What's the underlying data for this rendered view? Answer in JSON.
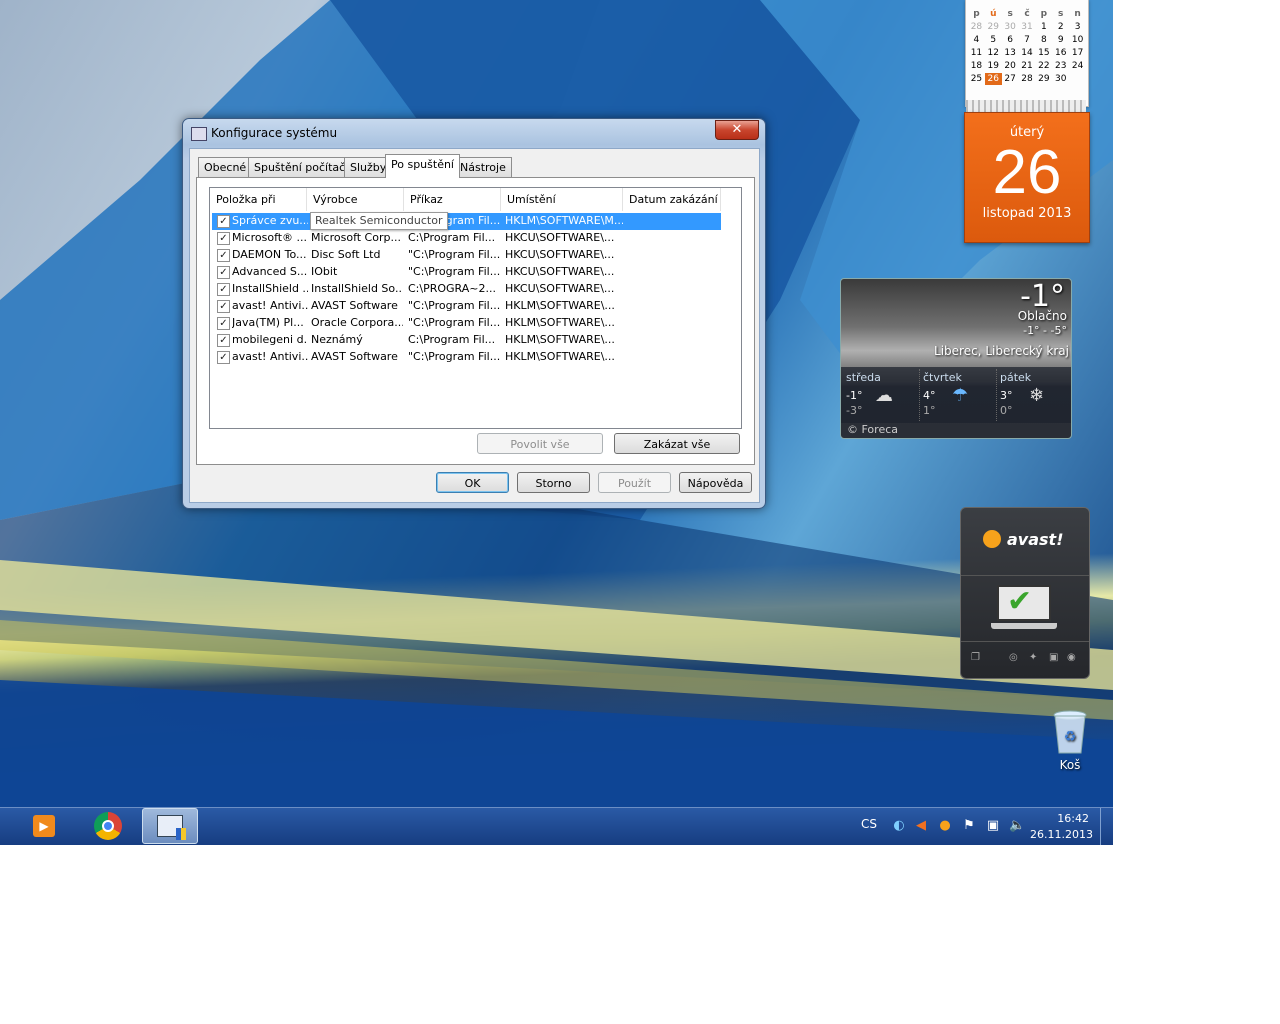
{
  "dialog": {
    "title": "Konfigurace systému",
    "close_label": "✕",
    "tabs": [
      {
        "label": "Obecné"
      },
      {
        "label": "Spuštění počítače"
      },
      {
        "label": "Služby"
      },
      {
        "label": "Po spuštění"
      },
      {
        "label": "Nástroje"
      }
    ],
    "active_tab": "Po spuštění",
    "columns": [
      "Položka při spu...",
      "Výrobce",
      "Příkaz",
      "Umístění",
      "Datum zakázání"
    ],
    "rows": [
      {
        "item": "Správce zvu...",
        "maker": "Realtek Semiconductor",
        "command": "\"C:\\Program Fil...",
        "location": "HKLM\\SOFTWARE\\M...",
        "date": "",
        "checked": true
      },
      {
        "item": "Microsoft® ...",
        "maker": "Microsoft Corp...",
        "command": "C:\\Program Fil...",
        "location": "HKCU\\SOFTWARE\\...",
        "date": "",
        "checked": true
      },
      {
        "item": "DAEMON To...",
        "maker": "Disc Soft Ltd",
        "command": "\"C:\\Program Fil...",
        "location": "HKCU\\SOFTWARE\\...",
        "date": "",
        "checked": true
      },
      {
        "item": "Advanced S...",
        "maker": "IObit",
        "command": "\"C:\\Program Fil...",
        "location": "HKCU\\SOFTWARE\\...",
        "date": "",
        "checked": true
      },
      {
        "item": "InstallShield ...",
        "maker": "InstallShield So...",
        "command": "C:\\PROGRA~2...",
        "location": "HKCU\\SOFTWARE\\...",
        "date": "",
        "checked": true
      },
      {
        "item": "avast! Antivi...",
        "maker": "AVAST Software",
        "command": "\"C:\\Program Fil...",
        "location": "HKLM\\SOFTWARE\\...",
        "date": "",
        "checked": true
      },
      {
        "item": "Java(TM) Pl...",
        "maker": "Oracle Corpora...",
        "command": "\"C:\\Program Fil...",
        "location": "HKLM\\SOFTWARE\\...",
        "date": "",
        "checked": true
      },
      {
        "item": "mobilegeni d...",
        "maker": "Neznámý",
        "command": "C:\\Program Fil...",
        "location": "HKLM\\SOFTWARE\\...",
        "date": "",
        "checked": true
      },
      {
        "item": "avast! Antivi...",
        "maker": "AVAST Software",
        "command": "\"C:\\Program Fil...",
        "location": "HKLM\\SOFTWARE\\...",
        "date": "",
        "checked": true
      }
    ],
    "tooltip": "Realtek Semiconductor",
    "enable_all": "Povolit vše",
    "disable_all": "Zakázat vše",
    "ok": "OK",
    "cancel": "Storno",
    "apply": "Použít",
    "help": "Nápověda"
  },
  "calendar": {
    "weekdays": [
      "p",
      "ú",
      "s",
      "č",
      "p",
      "s",
      "n"
    ],
    "weeks": [
      [
        "28",
        "29",
        "30",
        "31",
        "1",
        "2",
        "3"
      ],
      [
        "4",
        "5",
        "6",
        "7",
        "8",
        "9",
        "10"
      ],
      [
        "11",
        "12",
        "13",
        "14",
        "15",
        "16",
        "17"
      ],
      [
        "18",
        "19",
        "20",
        "21",
        "22",
        "23",
        "24"
      ],
      [
        "25",
        "26",
        "27",
        "28",
        "29",
        "30",
        ""
      ]
    ],
    "today": "26",
    "day_name": "úterý",
    "day_number": "26",
    "month_year": "listopad 2013",
    "accent": "#e26a19"
  },
  "weather": {
    "temp": "-1°",
    "condition": "Oblačno",
    "range": "-1° - -5°",
    "location": "Liberec, Liberecký kraj",
    "forecast": [
      {
        "day": "středa",
        "high": "-1°",
        "low": "-3°",
        "icon": "cloud-icon"
      },
      {
        "day": "čtvrtek",
        "high": "4°",
        "low": "1°",
        "icon": "rain-icon"
      },
      {
        "day": "pátek",
        "high": "3°",
        "low": "0°",
        "icon": "snow-icon"
      }
    ],
    "credit": "© Foreca"
  },
  "avast": {
    "brand": "avast!",
    "accent": "#f7a21b"
  },
  "desktop": {
    "recycle_bin_label": "Koš"
  },
  "taskbar": {
    "language": "CS",
    "time": "16:42",
    "date": "26.11.2013",
    "apps": [
      "media-player-icon",
      "chrome-icon",
      "msconfig-icon"
    ]
  }
}
